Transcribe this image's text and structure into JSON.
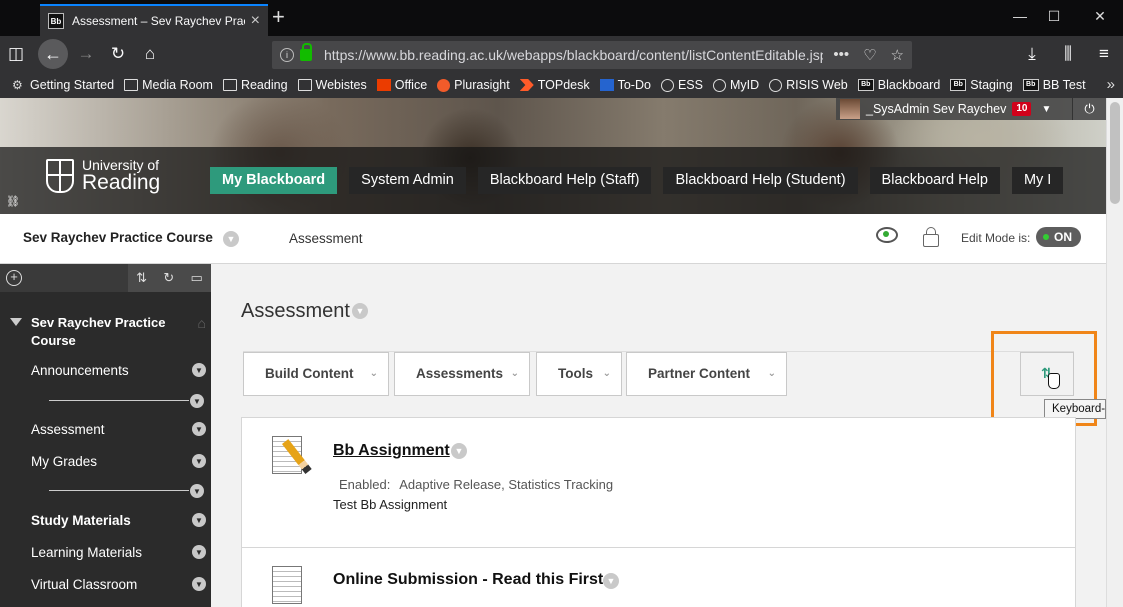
{
  "browser": {
    "tab_title": "Assessment – Sev Raychev Practice Course",
    "tab_favicon": "Bb",
    "new_tab": "+",
    "url": "https://www.bb.reading.ac.uk/webapps/blackboard/content/listContentEditable.jsp",
    "url_actions": [
      "•••",
      "pocket-icon",
      "star-icon"
    ],
    "bookmarks": [
      {
        "label": "Getting Started",
        "icon": "gear-icon"
      },
      {
        "label": "Media Room",
        "icon": "folder-icon"
      },
      {
        "label": "Reading",
        "icon": "folder-icon"
      },
      {
        "label": "Webistes",
        "icon": "folder-icon"
      },
      {
        "label": "Office",
        "icon": "office-icon"
      },
      {
        "label": "Plurasight",
        "icon": "pluralsight-icon"
      },
      {
        "label": "TOPdesk",
        "icon": "topdesk-icon"
      },
      {
        "label": "To-Do",
        "icon": "todo-icon"
      },
      {
        "label": "ESS",
        "icon": "globe-icon"
      },
      {
        "label": "MyID",
        "icon": "globe-icon"
      },
      {
        "label": "RISIS Web",
        "icon": "globe-icon"
      },
      {
        "label": "Blackboard",
        "icon": "bb-icon"
      },
      {
        "label": "Staging",
        "icon": "bb-icon"
      },
      {
        "label": "BB Test",
        "icon": "bb-icon"
      }
    ]
  },
  "banner": {
    "logo_line1": "University of",
    "logo_line2": "Reading",
    "tabs": [
      {
        "label": "My Blackboard",
        "active": true
      },
      {
        "label": "System Admin",
        "active": false
      },
      {
        "label": "Blackboard Help (Staff)",
        "active": false
      },
      {
        "label": "Blackboard Help (Student)",
        "active": false
      },
      {
        "label": "Blackboard Help",
        "active": false
      },
      {
        "label": "My I",
        "active": false
      }
    ],
    "user_name": "_SysAdmin Sev Raychev",
    "notification_count": "10"
  },
  "breadcrumb": {
    "course": "Sev Raychev Practice Course",
    "page": "Assessment",
    "edit_mode_label": "Edit Mode is:",
    "edit_mode_state": "ON"
  },
  "sidebar": {
    "course_title": "Sev Raychev Practice Course",
    "items": [
      {
        "label": "Announcements",
        "bold": false
      },
      {
        "label": "Assessment",
        "bold": false
      },
      {
        "label": "My Grades",
        "bold": false
      },
      {
        "label": "Study Materials",
        "bold": true
      },
      {
        "label": "Learning Materials",
        "bold": false
      },
      {
        "label": "Virtual Classroom",
        "bold": false
      }
    ]
  },
  "main": {
    "title": "Assessment",
    "actions": [
      {
        "label": "Build Content"
      },
      {
        "label": "Assessments"
      },
      {
        "label": "Tools"
      },
      {
        "label": "Partner Content"
      }
    ],
    "tooltip": "Keyboard-Ac",
    "items": [
      {
        "title": "Bb Assignment",
        "meta_label": "Enabled:",
        "meta_value": "Adaptive Release, Statistics Tracking",
        "description": "Test Bb Assignment"
      },
      {
        "title": "Online Submission - Read this First"
      }
    ]
  },
  "colors": {
    "accent": "#2e9a7c",
    "highlight": "#f08518",
    "badge": "#d0021b"
  }
}
